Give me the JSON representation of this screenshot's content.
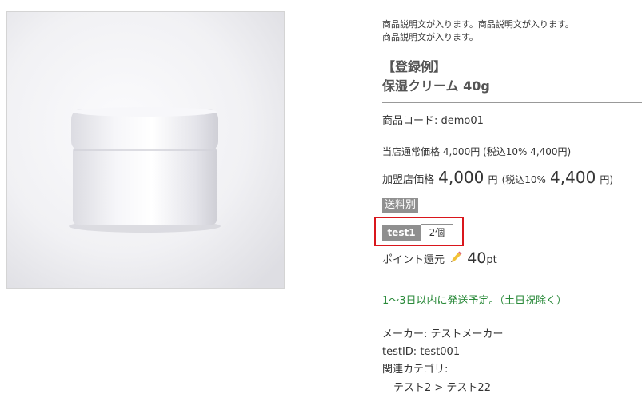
{
  "product": {
    "image_alt": "保湿クリーム 40g",
    "description_line1": "商品説明文が入ります。商品説明文が入ります。",
    "description_line2": "商品説明文が入ります。",
    "title_line1": "【登録例】",
    "title_line2": "保湿クリーム 40g",
    "code": "商品コード: demo01"
  },
  "pricing": {
    "regular_label": "当店通常価格",
    "regular_price": "4,000円",
    "regular_tax": "(税込10% 4,400円)",
    "member_label": "加盟店価格",
    "member_price": "4,000",
    "member_yen": "円",
    "member_tax_prefix": "(税込10%",
    "member_tax_value": "4,400",
    "member_tax_suffix": "円)"
  },
  "shipping_badge": "送料別",
  "variant": {
    "name": "test1",
    "quantity": "2個"
  },
  "points": {
    "label": "ポイント還元",
    "value": "40",
    "unit": "pt",
    "icon": "pencil-icon"
  },
  "delivery": "1〜3日以内に発送予定。（土日祝除く）",
  "specs": {
    "maker": "メーカー: テストメーカー",
    "test_id": "testID: test001",
    "category_label": "関連カテゴリ:",
    "category_path": "テスト2 > テスト22"
  },
  "colors": {
    "accent_red": "#d9161c",
    "delivery_green": "#2a8a3a",
    "badge_gray": "#8f8f8f"
  }
}
